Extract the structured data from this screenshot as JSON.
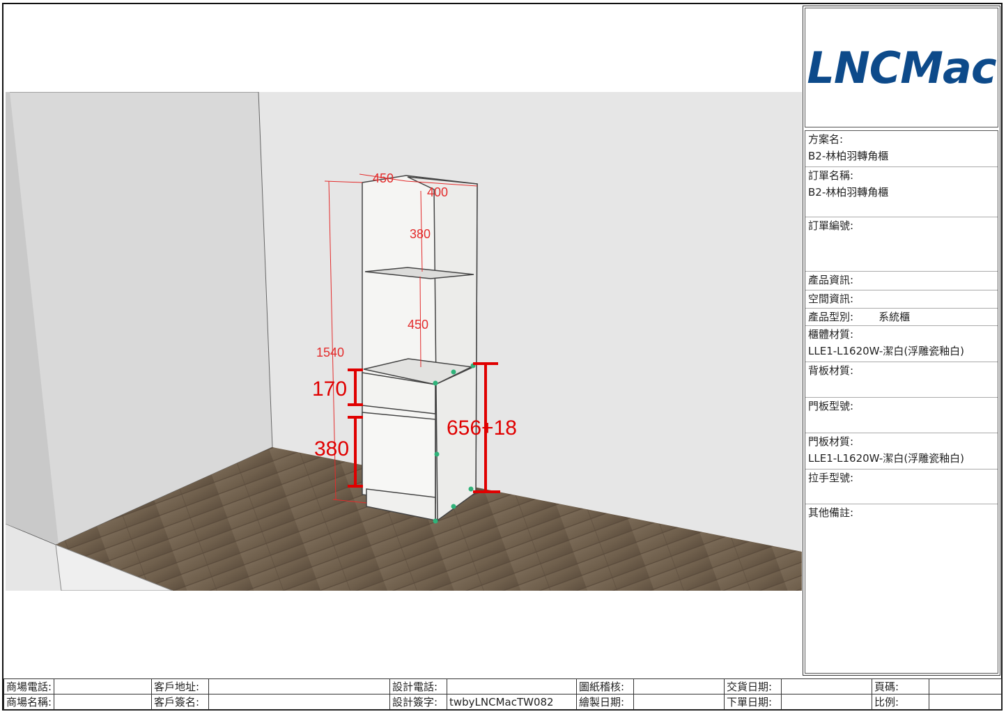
{
  "logo": {
    "text": "LNCMac"
  },
  "info": {
    "project_label": "方案名:",
    "project_value": "B2-林柏羽轉角櫃",
    "order_name_label": "訂單名稱:",
    "order_name_value": "B2-林柏羽轉角櫃",
    "order_no_label": "訂單編號:",
    "product_info_label": "產品資訊:",
    "space_info_label": "空間資訊:",
    "product_type_label": "產品型別:",
    "product_type_value": "系統櫃",
    "body_material_label": "櫃體材質:",
    "body_material_value": "LLE1-L1620W-潔白(浮雕瓷釉白)",
    "back_material_label": "背板材質:",
    "door_model_label": "門板型號:",
    "door_material_label": "門板材質:",
    "door_material_value": "LLE1-L1620W-潔白(浮雕瓷釉白)",
    "handle_model_label": "拉手型號:",
    "notes_label": "其他備註:"
  },
  "footer": {
    "store_phone": "商場電話:",
    "customer_address": "客戶地址:",
    "design_phone": "設計電話:",
    "drawing_review": "圖紙稽核:",
    "delivery_date": "交貨日期:",
    "page_no": "頁碼:",
    "store_name": "商場名稱:",
    "customer_sign": "客戶簽名:",
    "design_sign": "設計簽字:",
    "design_sign_value": "twbyLNCMacTW082",
    "draw_date": "繪製日期:",
    "order_date": "下單日期:",
    "scale": "比例:"
  },
  "dimensions": {
    "width_top": "450",
    "depth_top": "400",
    "upper_shelf": "380",
    "middle_shelf": "450",
    "total_height": "1540",
    "drawer": "170",
    "door": "380",
    "base_cabinet": "656+18"
  },
  "colors": {
    "logo": "#0d4a8a",
    "dimension": "#e32b2b",
    "marker": "#e00000",
    "handle": "#2fb37a"
  }
}
